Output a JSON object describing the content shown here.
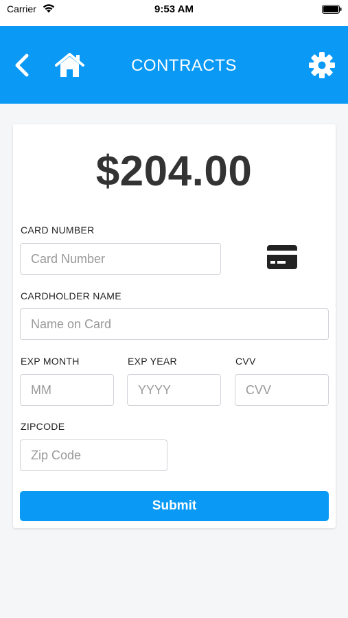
{
  "status_bar": {
    "carrier": "Carrier",
    "time": "9:53 AM"
  },
  "header": {
    "title": "CONTRACTS",
    "icons": [
      "back-icon",
      "home-icon",
      "gear-icon"
    ],
    "background_color": "#0a9af6"
  },
  "payment": {
    "amount": "$204.00",
    "card_number": {
      "label": "CARD NUMBER",
      "placeholder": "Card Number",
      "value": ""
    },
    "card_icon": "credit-card-icon",
    "cardholder_name": {
      "label": "CARDHOLDER NAME",
      "placeholder": "Name on Card",
      "value": ""
    },
    "exp_month": {
      "label": "EXP MONTH",
      "placeholder": "MM",
      "value": ""
    },
    "exp_year": {
      "label": "EXP YEAR",
      "placeholder": "YYYY",
      "value": ""
    },
    "cvv": {
      "label": "CVV",
      "placeholder": "CVV",
      "value": ""
    },
    "zipcode": {
      "label": "ZIPCODE",
      "placeholder": "Zip Code",
      "value": ""
    },
    "submit_label": "Submit"
  }
}
